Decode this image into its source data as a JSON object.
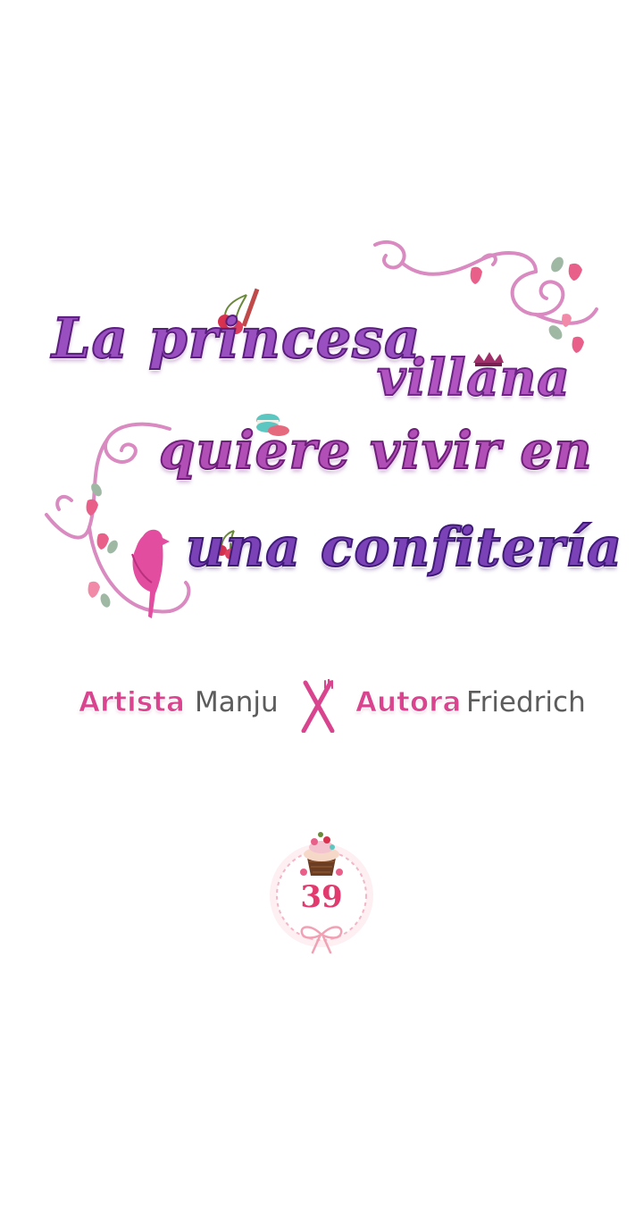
{
  "title": {
    "line1": "La princesa",
    "line2": "villana",
    "line3": "quiere vivir en",
    "line4": "una confitería"
  },
  "credits": {
    "artist_role": "Artista",
    "artist_name": "Manju",
    "author_role": "Autora",
    "author_name": "Friedrich",
    "separator_icon": "fork-knife-icon"
  },
  "chapter": {
    "number": "39",
    "icons": [
      "cupcake-icon",
      "ribbon-bow-icon"
    ]
  },
  "decorations": [
    "swirl-vine-icon",
    "bird-icon",
    "cherry-icon",
    "macaron-icon",
    "crown-icon",
    "strawberry-icon"
  ],
  "colors": {
    "background": "#ffffff",
    "title_purple": "#9a4fc1",
    "title_dark": "#5a1f7d",
    "credit_pink": "#d8458e",
    "credit_gray": "#5c5c5c",
    "chapter_red": "#e23a6e",
    "vine_pink": "#d98ac0"
  }
}
